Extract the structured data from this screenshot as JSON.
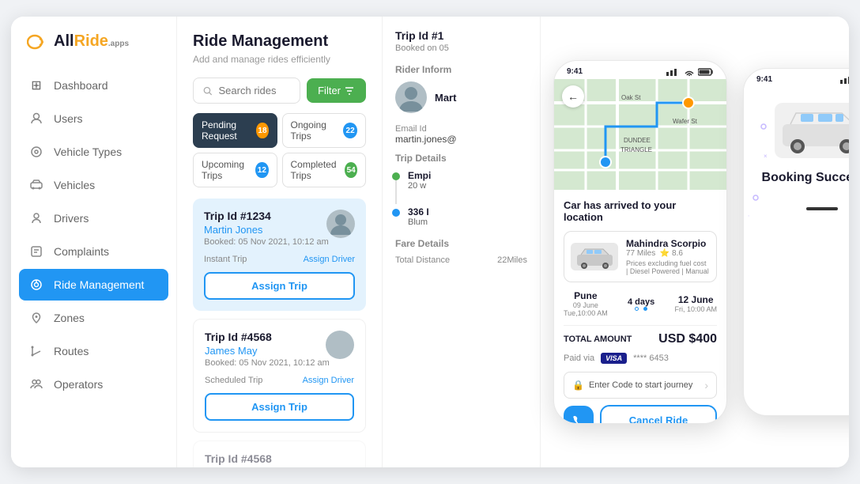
{
  "app": {
    "name": "AllRide",
    "name_color": "#f5a623",
    "tagline": "apps"
  },
  "sidebar": {
    "items": [
      {
        "id": "dashboard",
        "label": "Dashboard",
        "icon": "⊞",
        "active": false
      },
      {
        "id": "users",
        "label": "Users",
        "icon": "👤",
        "active": false
      },
      {
        "id": "vehicle-types",
        "label": "Vehicle Types",
        "icon": "🚗",
        "active": false
      },
      {
        "id": "vehicles",
        "label": "Vehicles",
        "icon": "🚙",
        "active": false
      },
      {
        "id": "drivers",
        "label": "Drivers",
        "icon": "🧑",
        "active": false
      },
      {
        "id": "complaints",
        "label": "Complaints",
        "icon": "📋",
        "active": false
      },
      {
        "id": "ride-management",
        "label": "Ride Management",
        "icon": "🛞",
        "active": true
      },
      {
        "id": "zones",
        "label": "Zones",
        "icon": "📍",
        "active": false
      },
      {
        "id": "routes",
        "label": "Routes",
        "icon": "🗺",
        "active": false
      },
      {
        "id": "operators",
        "label": "Operators",
        "icon": "👥",
        "active": false
      }
    ]
  },
  "ride_management": {
    "title": "Ride Management",
    "subtitle": "Add and manage rides efficiently",
    "search_placeholder": "Search rides",
    "filter_label": "Filter",
    "tabs": [
      {
        "id": "pending",
        "label": "Pending Request",
        "count": 18,
        "active": true
      },
      {
        "id": "ongoing",
        "label": "Ongoing Trips",
        "count": 22,
        "active": false
      },
      {
        "id": "upcoming",
        "label": "Upcoming Trips",
        "count": 12,
        "active": false
      },
      {
        "id": "completed",
        "label": "Completed Trips",
        "count": 54,
        "active": false
      }
    ],
    "trips": [
      {
        "id": "Trip Id #1234",
        "name": "Martin Jones",
        "date": "Booked: 05 Nov 2021, 10:12 am",
        "type": "Instant Trip",
        "assign_driver": "Assign Driver",
        "assign_trip": "Assign Trip",
        "highlight": true
      },
      {
        "id": "Trip Id #4568",
        "name": "James May",
        "date": "Booked: 05 Nov 2021, 10:12 am",
        "type": "Scheduled Trip",
        "assign_driver": "Assign Driver",
        "assign_trip": "Assign Trip",
        "highlight": false
      },
      {
        "id": "Trip Id #4568",
        "name": "",
        "date": "",
        "type": "",
        "assign_driver": "",
        "assign_trip": "",
        "highlight": false
      }
    ]
  },
  "trip_detail": {
    "id": "Trip Id #1",
    "date": "Booked on 05",
    "rider_info_label": "Rider Inform",
    "rider_name": "Mart",
    "email_label": "Email Id",
    "email": "martin.jones@",
    "trip_details_label": "Trip Details",
    "from": "Empi",
    "from_sub": "20 w",
    "to": "336 I",
    "to_sub": "Blum",
    "fare_label": "Fare Details",
    "total_distance": "Total Distance",
    "distance_val": "22Miles"
  },
  "phone1": {
    "time": "9:41",
    "status_icons": "▐ ▐ ▐ ⬛",
    "arrived_text": "Car has arrived to your location",
    "car_name": "Mahindra Scorpio",
    "car_distance": "77 Miles",
    "car_rating": "8.6",
    "car_specs": "Prices excluding fuel cost | Diesel Powered | Manual",
    "from_city": "Pune",
    "from_date": "09 June",
    "from_day": "Tue,10:00 AM",
    "to_city": "12 June",
    "to_day": "Fri, 10:00 AM",
    "days": "4 days",
    "total_label": "TOTAL AMOUNT",
    "total_amount": "USD $400",
    "paid_via": "Paid via",
    "visa_label": "VISA",
    "card_last4": "**** 6453",
    "code_label": "Enter Code to start journey",
    "cancel_label": "Cancel Ride"
  },
  "phone2": {
    "time": "9:41",
    "status_icons": "▐ ▐ ▐ ⬛",
    "booking_success_title": "Booking Successful"
  }
}
